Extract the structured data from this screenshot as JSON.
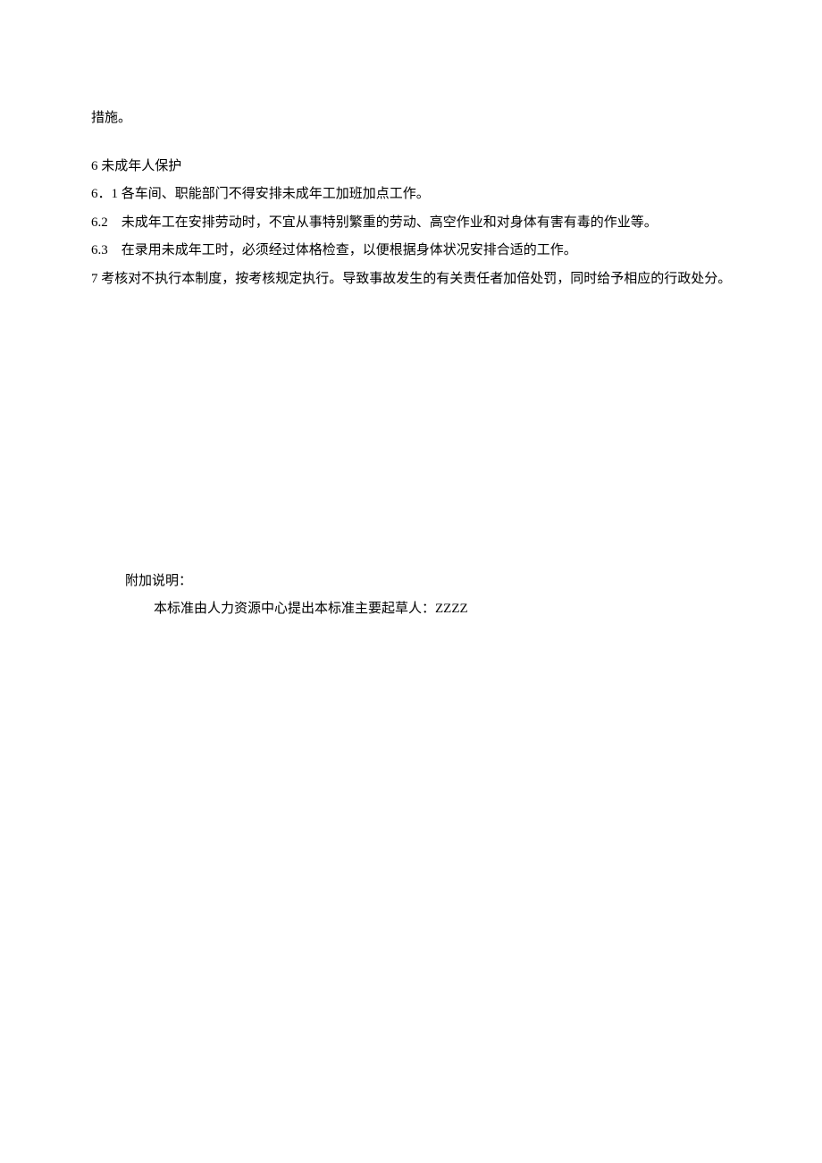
{
  "paragraphs": {
    "p1": "措施。",
    "p2": "6 未成年人保护",
    "p3": "6．1 各车间、职能部门不得安排未成年工加班加点工作。",
    "p4": "6.2　未成年工在安排劳动时，不宜从事特别繁重的劳动、高空作业和对身体有害有毒的作业等。",
    "p5": "6.3　在录用未成年工时，必须经过体格检查，以便根据身体状况安排合适的工作。",
    "p6": "7 考核对不执行本制度，按考核规定执行。导致事故发生的有关责任者加倍处罚，同时给予相应的行政处分。"
  },
  "appendix": {
    "title": "附加说明：",
    "body": "本标准由人力资源中心提出本标准主要起草人：ZZZZ"
  }
}
